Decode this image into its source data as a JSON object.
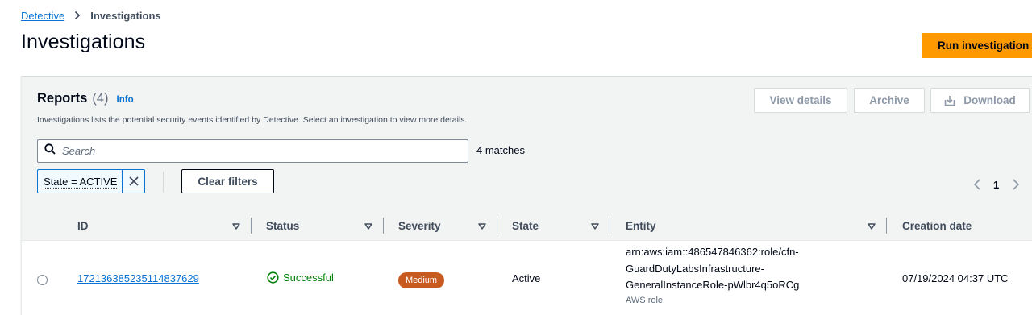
{
  "breadcrumb": {
    "root": "Detective",
    "current": "Investigations"
  },
  "page": {
    "title": "Investigations",
    "primary_action": "Run investigation"
  },
  "reports": {
    "title": "Reports",
    "count": "(4)",
    "info": "Info",
    "description": "Investigations lists the potential security events identified by Detective. Select an investigation to view more details.",
    "actions": {
      "view_details": "View details",
      "archive": "Archive",
      "download": "Download"
    }
  },
  "filter": {
    "search_placeholder": "Search",
    "matches": "4 matches",
    "token": "State = ACTIVE",
    "clear": "Clear filters"
  },
  "pagination": {
    "current_page": "1"
  },
  "table": {
    "columns": [
      "ID",
      "Status",
      "Severity",
      "State",
      "Entity",
      "Creation date"
    ],
    "rows": [
      {
        "id": "172136385235114837629",
        "status": "Successful",
        "severity": "Medium",
        "state": "Active",
        "entity_lines": [
          "arn:aws:iam::486547846362:role/cfn-",
          "GuardDutyLabsInfrastructure-",
          "GeneralInstanceRole-pWlbr4q5oRCg"
        ],
        "entity_type": "AWS role",
        "created": "07/19/2024 04:37 UTC"
      }
    ]
  },
  "colors": {
    "link": "#0972d3",
    "primary_button": "#ff9900",
    "success": "#037f0c",
    "severity_medium": "#c75a1e",
    "header_bg": "#f2f3f3"
  },
  "icons": {
    "breadcrumb_separator": "chevron-right-icon",
    "search": "search-icon",
    "remove_token": "close-icon",
    "download": "download-icon",
    "pager_prev": "chevron-left-icon",
    "pager_next": "chevron-right-icon",
    "sort": "caret-down-icon",
    "status": "status-check-icon"
  }
}
